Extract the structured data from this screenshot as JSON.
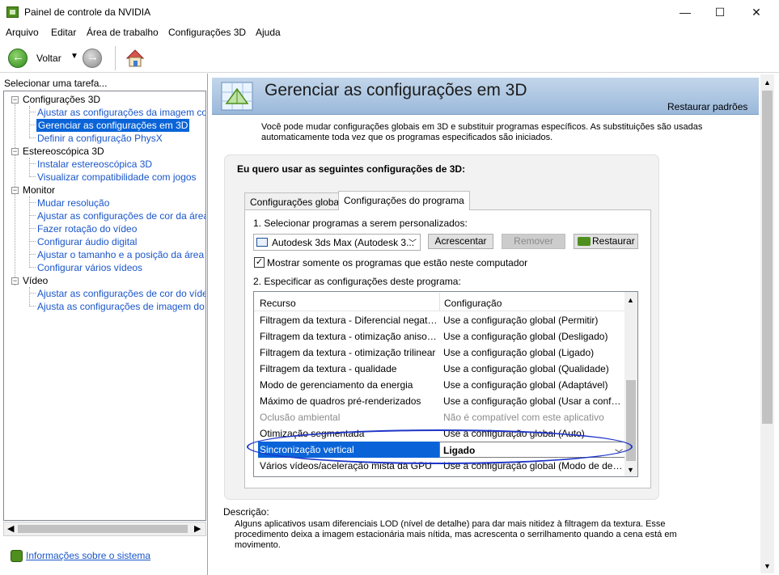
{
  "window": {
    "title": "Painel de controle da NVIDIA"
  },
  "menu": [
    "Arquivo",
    "Editar",
    "Área de trabalho",
    "Configurações 3D",
    "Ajuda"
  ],
  "toolbar": {
    "back_label": "Voltar"
  },
  "sidebar": {
    "task_label": "Selecionar uma tarefa...",
    "groups": [
      {
        "label": "Configurações 3D",
        "items": [
          "Ajustar as configurações da imagem com a",
          "Gerenciar as configurações em 3D",
          "Definir a configuração PhysX"
        ]
      },
      {
        "label": "Estereoscópica 3D",
        "items": [
          "Instalar estereoscópica 3D",
          "Visualizar compatibilidade com jogos"
        ]
      },
      {
        "label": "Monitor",
        "items": [
          "Mudar resolução",
          "Ajustar as configurações de cor da área de",
          "Fazer rotação do vídeo",
          "Configurar áudio digital",
          "Ajustar o tamanho e a posição da área de",
          "Configurar vários vídeos"
        ]
      },
      {
        "label": "Vídeo",
        "items": [
          "Ajustar as configurações de cor do vídeo",
          "Ajusta as configurações de imagem do víde"
        ]
      }
    ],
    "selected_item": "Gerenciar as configurações em 3D",
    "system_info_link": "Informações sobre o sistema"
  },
  "main": {
    "title": "Gerenciar as configurações em 3D",
    "restore_defaults": "Restaurar padrões",
    "intro": "Você pode mudar configurações globais em 3D e substituir programas específicos. As substituições são usadas automaticamente toda vez que os programas especificados são iniciados.",
    "group_title": "Eu quero usar as seguintes configurações de 3D:",
    "tabs": [
      "Configurações globais",
      "Configurações do programa"
    ],
    "active_tab": "Configurações do programa",
    "step1_label": "1. Selecionar programas a serem personalizados:",
    "program_select_value": "Autodesk 3ds Max (Autodesk 3...",
    "buttons": {
      "add": "Acrescentar",
      "remove": "Remover",
      "restore": "Restaurar"
    },
    "checkbox_label": "Mostrar somente os programas que estão neste computador",
    "checkbox_checked": true,
    "step2_label": "2. Especificar as configurações deste programa:",
    "table": {
      "headers": [
        "Recurso",
        "Configuração"
      ],
      "rows": [
        {
          "resource": "Filtragem da textura - Diferencial negativo...",
          "config": "Use a configuração global (Permitir)",
          "state": "normal"
        },
        {
          "resource": "Filtragem da textura - otimização anisotró...",
          "config": "Use a configuração global (Desligado)",
          "state": "normal"
        },
        {
          "resource": "Filtragem da textura - otimização trilinear",
          "config": "Use a configuração global (Ligado)",
          "state": "normal"
        },
        {
          "resource": "Filtragem da textura - qualidade",
          "config": "Use a configuração global (Qualidade)",
          "state": "normal"
        },
        {
          "resource": "Modo de gerenciamento da energia",
          "config": "Use a configuração global (Adaptável)",
          "state": "normal"
        },
        {
          "resource": "Máximo de quadros pré-renderizados",
          "config": "Use a configuração global (Usar a configur...",
          "state": "normal"
        },
        {
          "resource": "Oclusão ambiental",
          "config": "Não é compatível com este aplicativo",
          "state": "disabled"
        },
        {
          "resource": "Otimização segmentada",
          "config": "Use a configuração global (Auto)",
          "state": "normal"
        },
        {
          "resource": "Sincronização vertical",
          "config": "Ligado",
          "state": "selected"
        },
        {
          "resource": "Vários vídeos/aceleração mista da GPU",
          "config": "Use a configuração global (Modo de dese...",
          "state": "normal"
        }
      ]
    },
    "description_label": "Descrição:",
    "description": "Alguns aplicativos usam diferenciais LOD (nível de detalhe) para dar mais nitidez à filtragem da textura. Esse procedimento deixa a imagem estacionária mais nítida, mas acrescenta o serrilhamento quando a cena está em movimento."
  },
  "colors": {
    "selection": "#0a64d8",
    "link": "#1a56c9",
    "annotation": "#1f35c8",
    "nvidia_green": "#4e8f1d"
  }
}
